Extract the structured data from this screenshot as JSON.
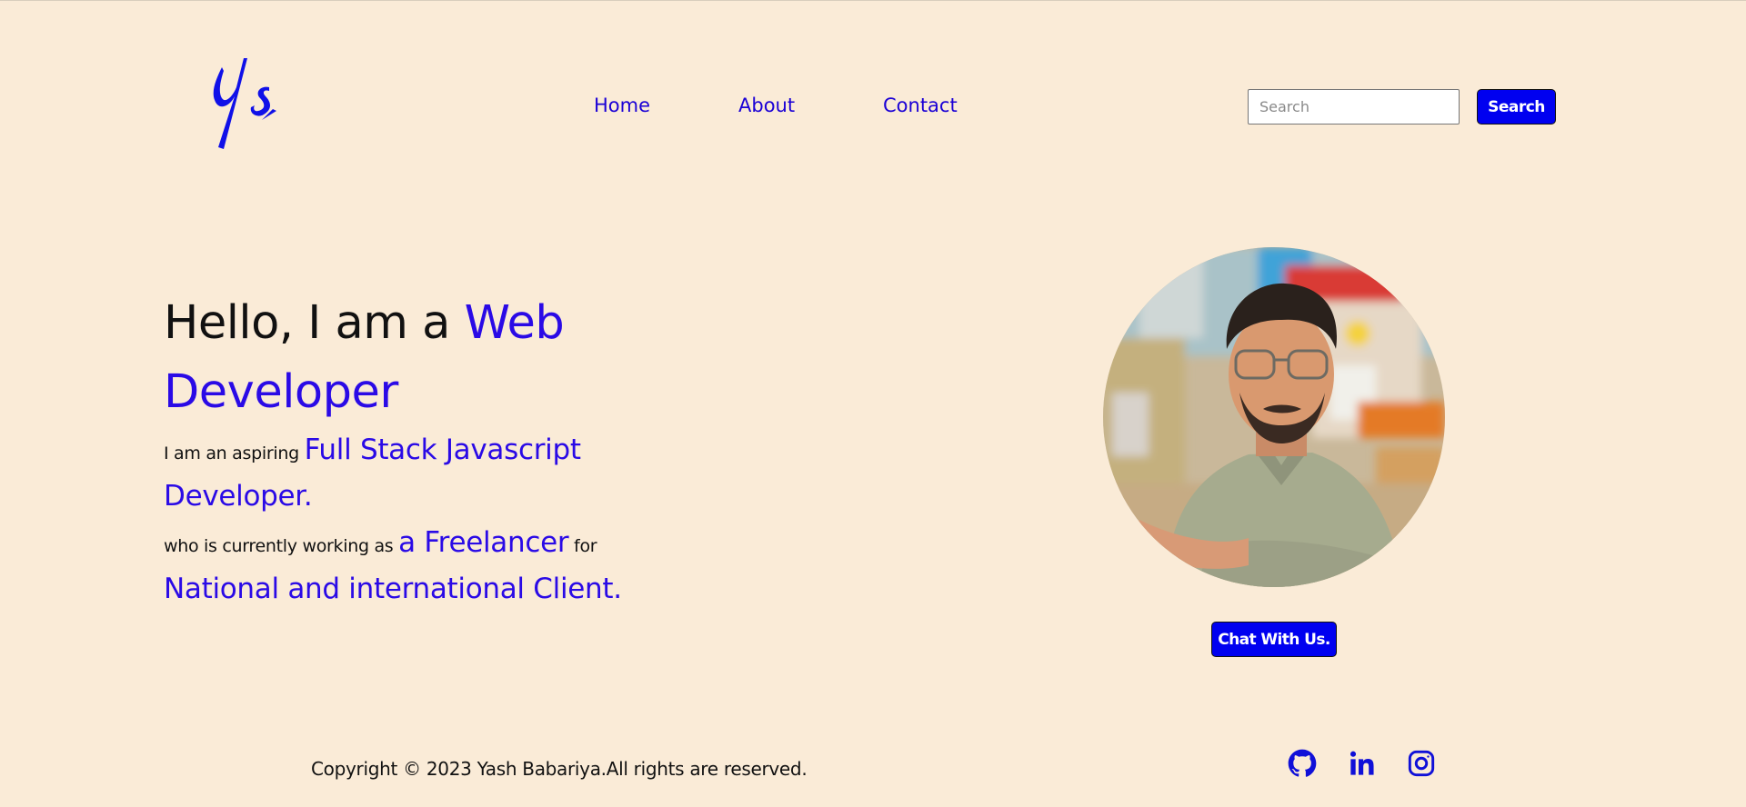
{
  "header": {
    "logo_text": "Ys",
    "nav": [
      {
        "label": "Home"
      },
      {
        "label": "About"
      },
      {
        "label": "Contact"
      }
    ],
    "search": {
      "placeholder": "Search",
      "value": "",
      "button_label": "Search"
    }
  },
  "hero": {
    "heading_prefix": "Hello, I am a ",
    "heading_highlight_1": "Web",
    "heading_highlight_2": "Developer",
    "line2_prefix": "I am an aspiring ",
    "line2_highlight": "Full Stack Javascript Developer.",
    "line3_prefix": "who is currently working as ",
    "line3_highlight": "a Freelancer",
    "line3_mid": " for",
    "line3_highlight_2": "National and international Client."
  },
  "profile": {
    "chat_button_label": "Chat With Us."
  },
  "footer": {
    "copyright": "Copyright © 2023 Yash Babariya.All rights are reserved.",
    "social": [
      "github-icon",
      "linkedin-icon",
      "instagram-icon"
    ]
  },
  "colors": {
    "background": "#faebd7",
    "accent": "#1a00d6",
    "button": "#0000f0"
  }
}
